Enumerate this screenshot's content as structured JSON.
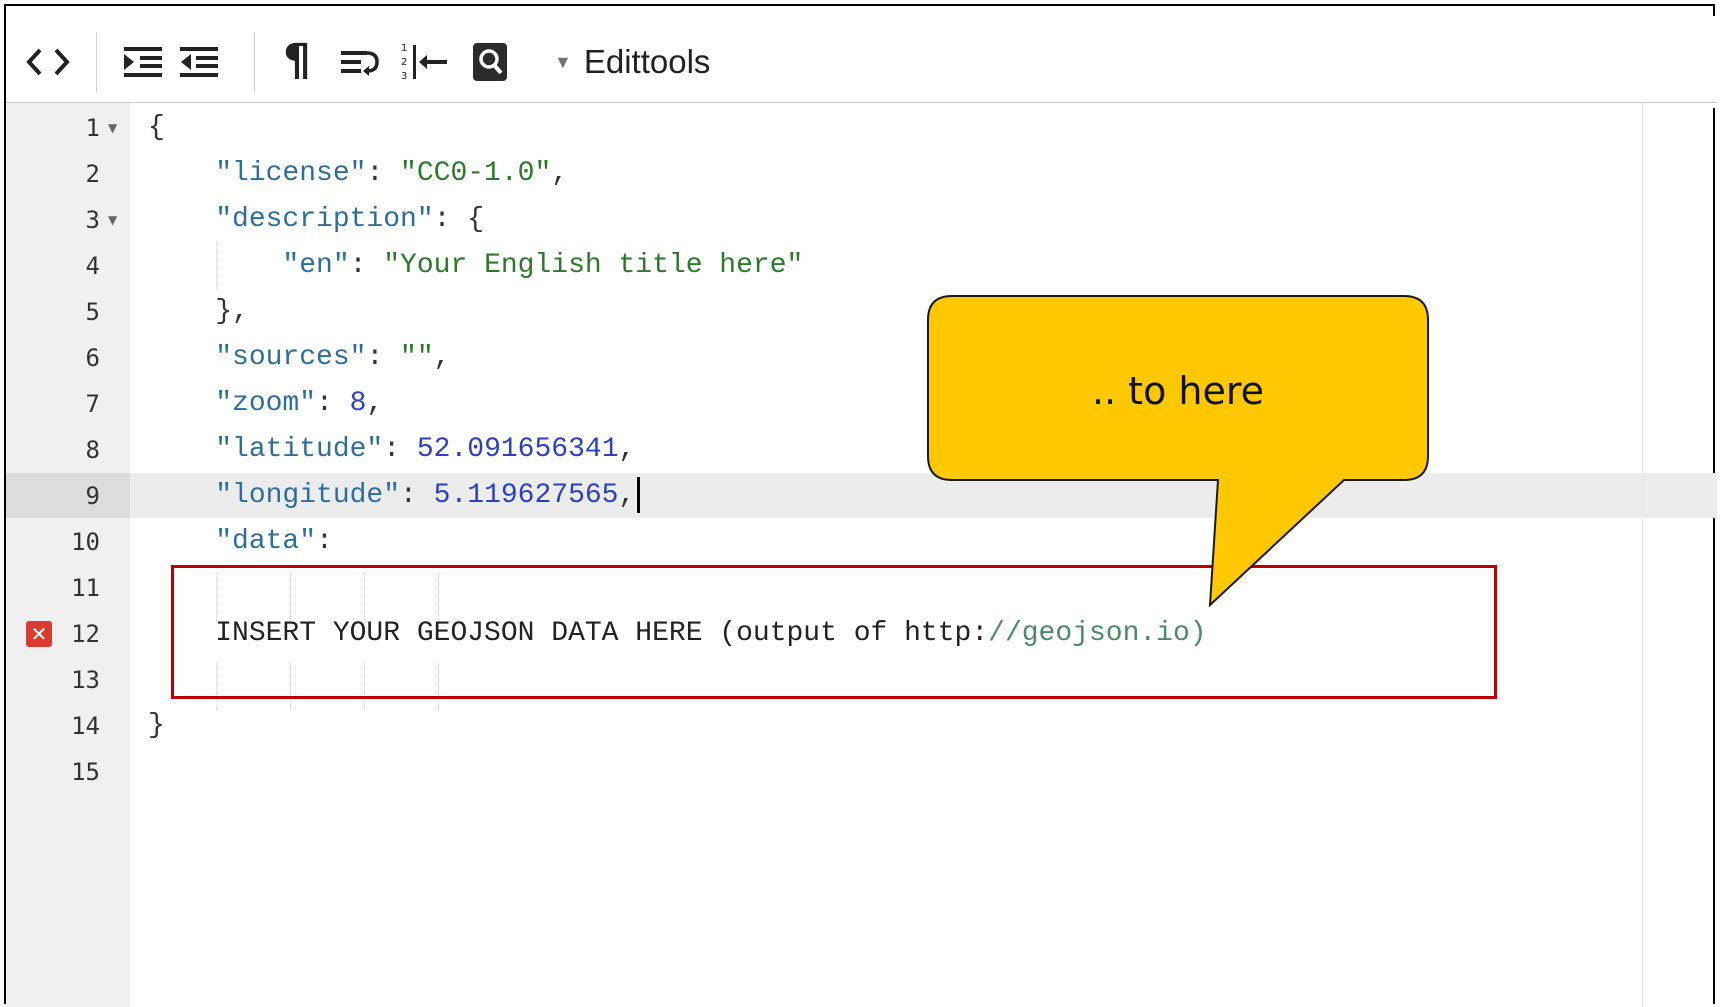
{
  "toolbar": {
    "buttons": [
      {
        "name": "code-toggle-icon",
        "glyph": "<>"
      },
      {
        "name": "indent-icon",
        "glyph": "⇥"
      },
      {
        "name": "outdent-icon",
        "glyph": "⇤"
      },
      {
        "name": "pilcrow-icon",
        "glyph": "¶"
      },
      {
        "name": "wrap-icon",
        "glyph": "↩"
      },
      {
        "name": "goto-line-icon",
        "glyph": "⇤"
      },
      {
        "name": "search-icon",
        "glyph": "🔍"
      }
    ],
    "edittools_label": "Edittools"
  },
  "lines": [
    {
      "n": "1",
      "fold": true,
      "code": "{"
    },
    {
      "n": "2",
      "code": "    \"license\": \"CC0-1.0\","
    },
    {
      "n": "3",
      "fold": true,
      "code": "    \"description\": {"
    },
    {
      "n": "4",
      "code": "        \"en\": \"Your English title here\""
    },
    {
      "n": "5",
      "code": "    },"
    },
    {
      "n": "6",
      "code": "    \"sources\": \"\","
    },
    {
      "n": "7",
      "code": "    \"zoom\": 8,"
    },
    {
      "n": "8",
      "code": "    \"latitude\": 52.091656341,"
    },
    {
      "n": "9",
      "code": "    \"longitude\": 5.119627565,",
      "active": true
    },
    {
      "n": "10",
      "code": "    \"data\":"
    },
    {
      "n": "11",
      "code": ""
    },
    {
      "n": "12",
      "error": true,
      "code": "    INSERT YOUR GEOJSON DATA HERE (output of http://geojson.io)"
    },
    {
      "n": "13",
      "code": ""
    },
    {
      "n": "14",
      "code": "}"
    },
    {
      "n": "15",
      "code": ""
    }
  ],
  "callout": {
    "text": ".. to here",
    "fill": "#ffc800"
  },
  "highlight_color": "#c00000"
}
